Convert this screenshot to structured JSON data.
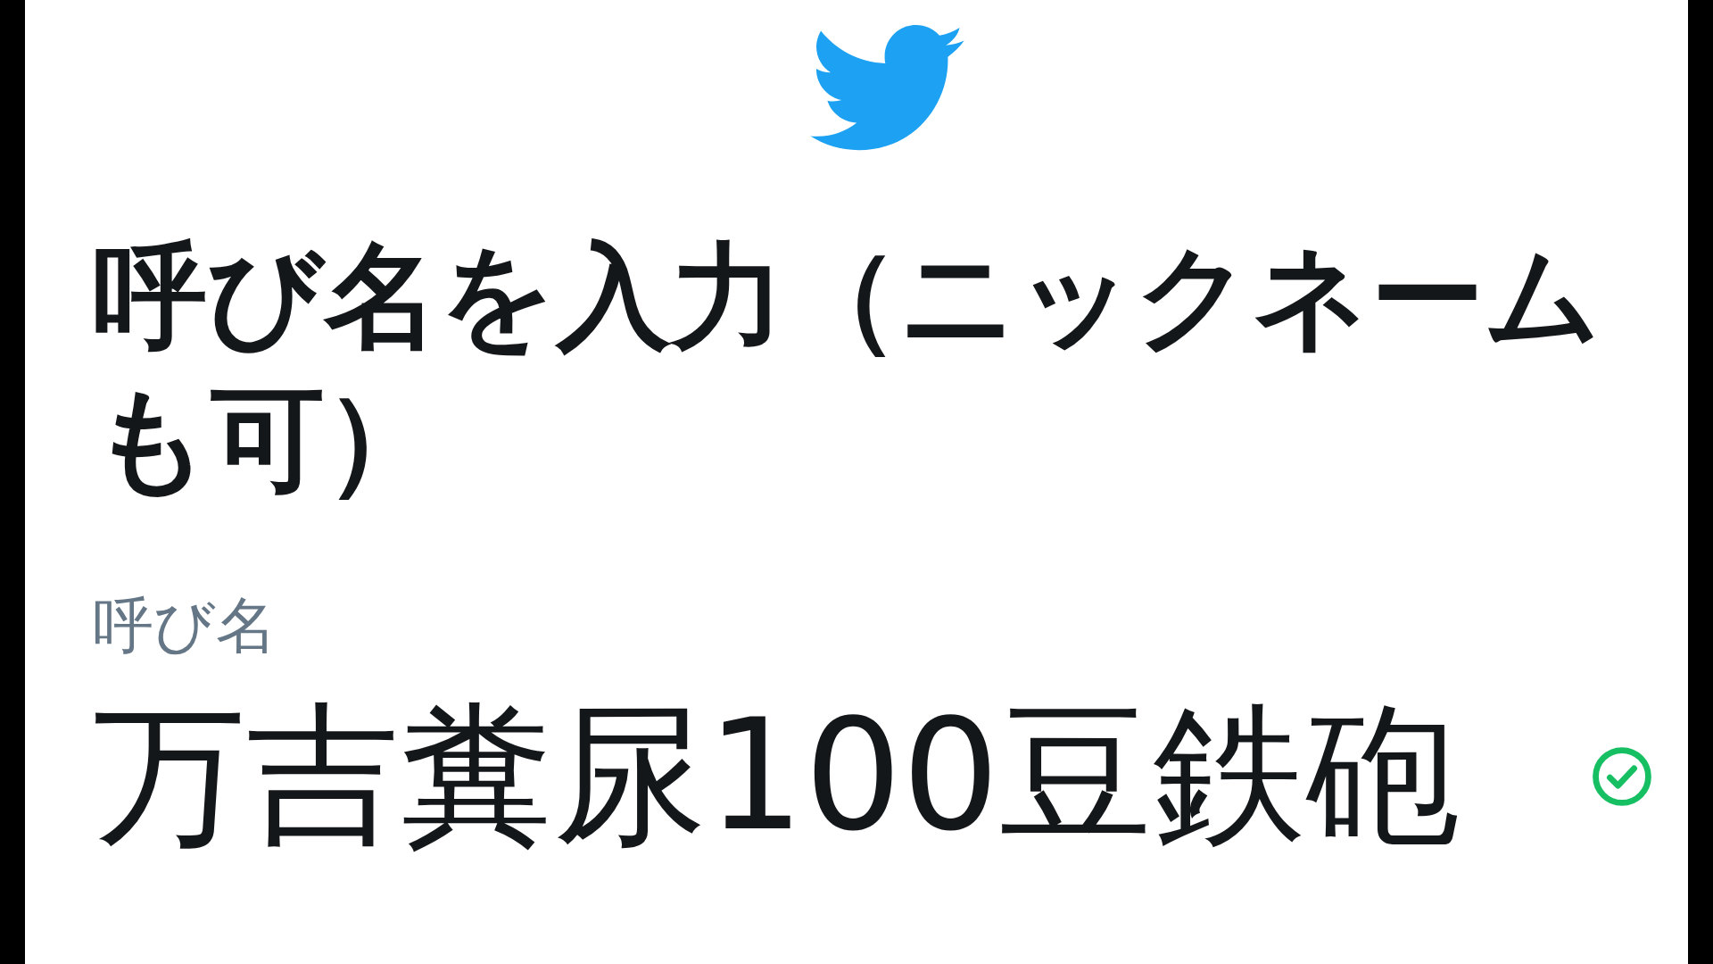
{
  "heading": "呼び名を入力（ニックネームも可）",
  "field": {
    "label": "呼び名",
    "value": "万吉糞尿100豆鉄砲",
    "valid": true
  }
}
